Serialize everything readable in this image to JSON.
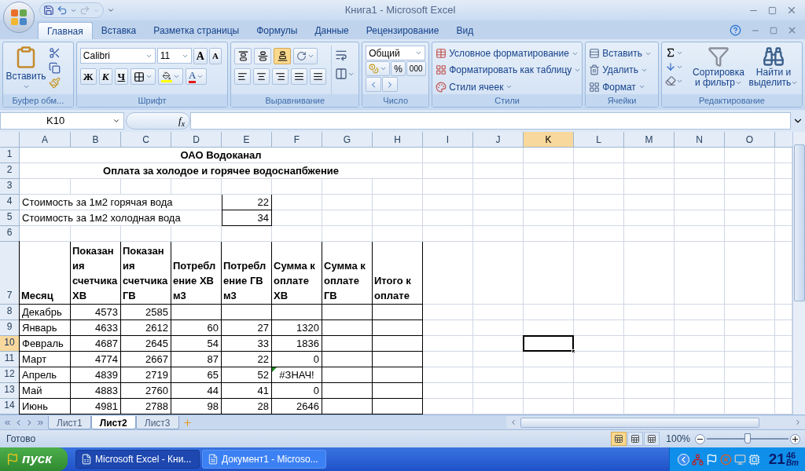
{
  "window": {
    "title": "Книга1 - Microsoft Excel"
  },
  "tabs": [
    {
      "label": "Главная",
      "selected": true
    },
    {
      "label": "Вставка",
      "selected": false
    },
    {
      "label": "Разметка страницы",
      "selected": false
    },
    {
      "label": "Формулы",
      "selected": false
    },
    {
      "label": "Данные",
      "selected": false
    },
    {
      "label": "Рецензирование",
      "selected": false
    },
    {
      "label": "Вид",
      "selected": false
    }
  ],
  "ribbon": {
    "clipboard": {
      "paste": "Вставить",
      "label": "Буфер обм..."
    },
    "font": {
      "family": "Calibri",
      "size": "11",
      "grow": "A",
      "shrink": "A",
      "bold": "Ж",
      "italic": "К",
      "underline": "Ч",
      "color_letter": "A",
      "label": "Шрифт"
    },
    "alignment": {
      "vertical_align": [
        {
          "selected": false
        },
        {
          "selected": false
        },
        {
          "selected": true
        }
      ],
      "label": "Выравнивание"
    },
    "number": {
      "format": "Общий",
      "percent": "%",
      "thousands": "000",
      "label": "Число"
    },
    "styles": {
      "items": [
        "Условное форматирование",
        "Форматировать как таблицу",
        "Стили ячеек"
      ],
      "label": "Стили"
    },
    "cells": {
      "items": [
        "Вставить",
        "Удалить",
        "Формат"
      ],
      "label": "Ячейки"
    },
    "editing": {
      "sort": "Сортировка и фильтр",
      "find": "Найти и выделить",
      "label": "Редактирование"
    }
  },
  "formula_bar": {
    "name_box": "K10",
    "function_label": "f$_{x}$"
  },
  "columns": [
    {
      "label": "A",
      "selected": false
    },
    {
      "label": "B",
      "selected": false
    },
    {
      "label": "C",
      "selected": false
    },
    {
      "label": "D",
      "selected": false
    },
    {
      "label": "E",
      "selected": false
    },
    {
      "label": "F",
      "selected": false
    },
    {
      "label": "G",
      "selected": false
    },
    {
      "label": "H",
      "selected": false
    },
    {
      "label": "I",
      "selected": false
    },
    {
      "label": "J",
      "selected": false
    },
    {
      "label": "K",
      "selected": true
    },
    {
      "label": "L",
      "selected": false
    },
    {
      "label": "M",
      "selected": false
    },
    {
      "label": "N",
      "selected": false
    },
    {
      "label": "O",
      "selected": false
    }
  ],
  "rows": [
    {
      "number": "1",
      "selected": false,
      "kind": "title",
      "text": "ОАО Водоканал"
    },
    {
      "number": "2",
      "selected": false,
      "kind": "title",
      "text": "Оплата за холодое и горячее водоснапбжение"
    },
    {
      "number": "3",
      "selected": false,
      "kind": "blank"
    },
    {
      "number": "4",
      "selected": false,
      "kind": "param",
      "label": "Стоимость за 1м2 горячая вода",
      "value": "22"
    },
    {
      "number": "5",
      "selected": false,
      "kind": "param",
      "label": "Стоимость за 1м2 холодная вода",
      "value": "34"
    },
    {
      "number": "6",
      "selected": false,
      "kind": "blank"
    },
    {
      "number": "7",
      "selected": false,
      "kind": "header",
      "cells": [
        "Месяц",
        "Показания счетчика ХВ",
        "Показания счетчика ГВ",
        "Потребление ХВ м3",
        "Потребление ГВ м3",
        "Сумма к оплате ХВ",
        "Сумма к оплате ГВ",
        "Итого к оплате"
      ]
    },
    {
      "number": "8",
      "selected": false,
      "kind": "data",
      "cells": [
        {
          "kind": "text",
          "text": "Декабрь",
          "flagged": false
        },
        {
          "kind": "number",
          "text": "4573",
          "flagged": false
        },
        {
          "kind": "number",
          "text": "2585",
          "flagged": false
        },
        null,
        null,
        null,
        null,
        null
      ]
    },
    {
      "number": "9",
      "selected": false,
      "kind": "data",
      "cells": [
        {
          "kind": "text",
          "text": "Январь",
          "flagged": false
        },
        {
          "kind": "number",
          "text": "4633",
          "flagged": false
        },
        {
          "kind": "number",
          "text": "2612",
          "flagged": false
        },
        {
          "kind": "number",
          "text": "60",
          "flagged": false
        },
        {
          "kind": "number",
          "text": "27",
          "flagged": false
        },
        {
          "kind": "number",
          "text": "1320",
          "flagged": false
        },
        null,
        null
      ]
    },
    {
      "number": "10",
      "selected": true,
      "kind": "data",
      "cells": [
        {
          "kind": "text",
          "text": "Февраль",
          "flagged": false
        },
        {
          "kind": "number",
          "text": "4687",
          "flagged": false
        },
        {
          "kind": "number",
          "text": "2645",
          "flagged": false
        },
        {
          "kind": "number",
          "text": "54",
          "flagged": false
        },
        {
          "kind": "number",
          "text": "33",
          "flagged": false
        },
        {
          "kind": "number",
          "text": "1836",
          "flagged": false
        },
        null,
        null
      ]
    },
    {
      "number": "11",
      "selected": false,
      "kind": "data",
      "cells": [
        {
          "kind": "text",
          "text": "Март",
          "flagged": false
        },
        {
          "kind": "number",
          "text": "4774",
          "flagged": false
        },
        {
          "kind": "number",
          "text": "2667",
          "flagged": false
        },
        {
          "kind": "number",
          "text": "87",
          "flagged": false
        },
        {
          "kind": "number",
          "text": "22",
          "flagged": false
        },
        {
          "kind": "number",
          "text": "0",
          "flagged": false
        },
        null,
        null
      ]
    },
    {
      "number": "12",
      "selected": false,
      "kind": "data",
      "cells": [
        {
          "kind": "text",
          "text": "Апрель",
          "flagged": false
        },
        {
          "kind": "number",
          "text": "4839",
          "flagged": false
        },
        {
          "kind": "number",
          "text": "2719",
          "flagged": false
        },
        {
          "kind": "number",
          "text": "65",
          "flagged": false
        },
        {
          "kind": "number",
          "text": "52",
          "flagged": false
        },
        {
          "kind": "error",
          "text": "#ЗНАЧ!",
          "flagged": true
        },
        null,
        null
      ]
    },
    {
      "number": "13",
      "selected": false,
      "kind": "data",
      "cells": [
        {
          "kind": "text",
          "text": "Май",
          "flagged": false
        },
        {
          "kind": "number",
          "text": "4883",
          "flagged": false
        },
        {
          "kind": "number",
          "text": "2760",
          "flagged": false
        },
        {
          "kind": "number",
          "text": "44",
          "flagged": false
        },
        {
          "kind": "number",
          "text": "41",
          "flagged": false
        },
        {
          "kind": "number",
          "text": "0",
          "flagged": false
        },
        null,
        null
      ]
    },
    {
      "number": "14",
      "selected": false,
      "kind": "data",
      "cells": [
        {
          "kind": "text",
          "text": "Июнь",
          "flagged": false
        },
        {
          "kind": "number",
          "text": "4981",
          "flagged": false
        },
        {
          "kind": "number",
          "text": "2788",
          "flagged": false
        },
        {
          "kind": "number",
          "text": "98",
          "flagged": false
        },
        {
          "kind": "number",
          "text": "28",
          "flagged": false
        },
        {
          "kind": "number",
          "text": "2646",
          "flagged": false
        },
        null,
        null
      ]
    }
  ],
  "sheet_tabs": [
    {
      "label": "Лист1",
      "selected": false
    },
    {
      "label": "Лист2",
      "selected": true
    },
    {
      "label": "Лист3",
      "selected": false
    }
  ],
  "status_bar": {
    "status": "Готово",
    "views": [
      {
        "selected": true
      },
      {
        "selected": false
      },
      {
        "selected": false
      }
    ],
    "zoom": "100%",
    "zoom_slider": {
      "level": 0.5
    }
  },
  "taskbar": {
    "start": "пуск",
    "tasks": [
      {
        "label": "Microsoft Excel - Кни...",
        "selected": true
      },
      {
        "label": "Документ1 - Microso...",
        "selected": false
      }
    ],
    "clock": {
      "hours": "21",
      "minutes": "46",
      "day": "Вт"
    }
  }
}
